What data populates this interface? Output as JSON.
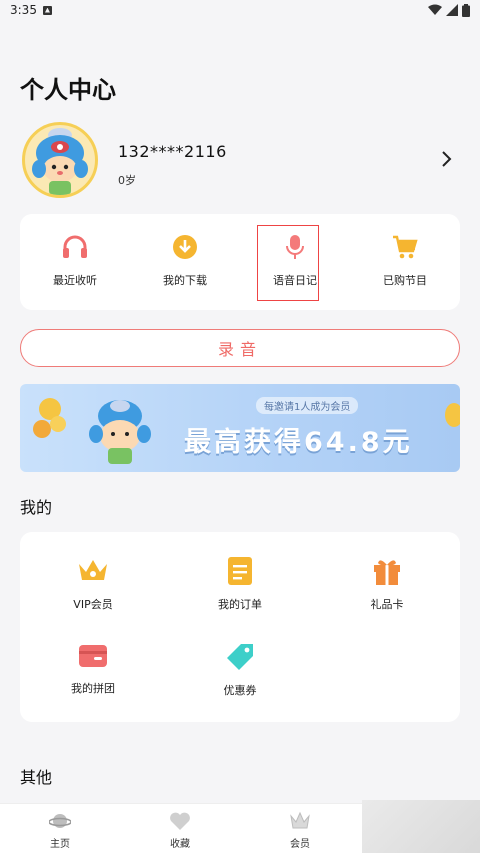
{
  "status_bar": {
    "time": "3:35"
  },
  "page": {
    "title": "个人中心"
  },
  "profile": {
    "name": "132****2116",
    "age": "0岁"
  },
  "quick_actions": [
    {
      "label": "最近收听",
      "icon": "headphones-icon",
      "color": "#f06d6d"
    },
    {
      "label": "我的下载",
      "icon": "download-icon",
      "color": "#f5b530"
    },
    {
      "label": "语音日记",
      "icon": "microphone-icon",
      "color": "#f47a7a"
    },
    {
      "label": "已购节目",
      "icon": "cart-icon",
      "color": "#f5b530"
    }
  ],
  "record_button": {
    "label": "录音"
  },
  "banner": {
    "subtitle": "每邀请1人成为会员",
    "headline": "最高获得64.8元"
  },
  "mine_section": {
    "title": "我的",
    "items": [
      {
        "label": "VIP会员",
        "icon": "crown-icon"
      },
      {
        "label": "我的订单",
        "icon": "order-icon"
      },
      {
        "label": "礼品卡",
        "icon": "gift-icon"
      },
      {
        "label": "我的拼团",
        "icon": "wallet-icon"
      },
      {
        "label": "优惠券",
        "icon": "coupon-tag-icon"
      }
    ]
  },
  "other_section": {
    "title": "其他"
  },
  "tabbar": {
    "items": [
      {
        "label": "主页",
        "icon": "planet-icon"
      },
      {
        "label": "收藏",
        "icon": "heart-icon"
      },
      {
        "label": "会员",
        "icon": "crown-outline-icon"
      }
    ]
  },
  "colors": {
    "accent": "#ef6a66",
    "yellow": "#f5b530",
    "banner": "#b3d2f7"
  }
}
